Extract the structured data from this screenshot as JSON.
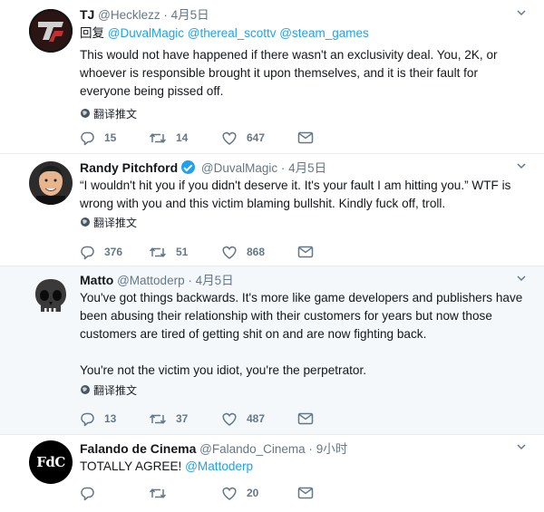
{
  "tweets": [
    {
      "name": "TJ",
      "handle": "@Hecklezz",
      "time": "4月5日",
      "reply_prefix": "回复",
      "reply_mentions": [
        "@DuvalMagic",
        "@thereal_scottv",
        "@steam_games"
      ],
      "text": "This would not have happened if there wasn't an exclusivity deal. You, 2K, or whoever is responsible brought it upon themselves, and it is their fault for everyone being pissed off.",
      "translate": "翻译推文",
      "replies": "15",
      "retweets": "14",
      "likes": "647"
    },
    {
      "name": "Randy Pitchford",
      "verified": true,
      "handle": "@DuvalMagic",
      "time": "4月5日",
      "text": "“I wouldn't hit you if you didn't deserve it.  It's your fault I am hitting you.” WTF is wrong with you and this victim blaming bullshit.  Kindly fuck off, troll.",
      "translate": "翻译推文",
      "replies": "376",
      "retweets": "51",
      "likes": "868"
    },
    {
      "name": "Matto",
      "handle": "@Mattoderp",
      "time": "4月5日",
      "text1": "You've got things backwards. It's more like game developers and publishers have been abusing their relationship with their customers for years but now those customers are tired of getting shit on and are now fighting back.",
      "text2": "You're not the victim you idiot, you're the perpetrator.",
      "translate": "翻译推文",
      "replies": "13",
      "retweets": "37",
      "likes": "487"
    },
    {
      "name": "Falando de Cinema",
      "handle": "@Falando_Cinema",
      "time": "9小时",
      "text": "TOTALLY AGREE!",
      "mention": "@Mattoderp",
      "avatar_text": "FdC",
      "likes": "20"
    }
  ],
  "colors": {
    "link": "#1da1f2",
    "muted": "#657786",
    "highlight_bg": "#f5f8fa",
    "divider": "#e6ecf0"
  },
  "icons": [
    "reply-icon",
    "retweet-icon",
    "like-icon",
    "dm-icon",
    "globe-icon",
    "caret-down-icon",
    "verified-badge-icon"
  ]
}
